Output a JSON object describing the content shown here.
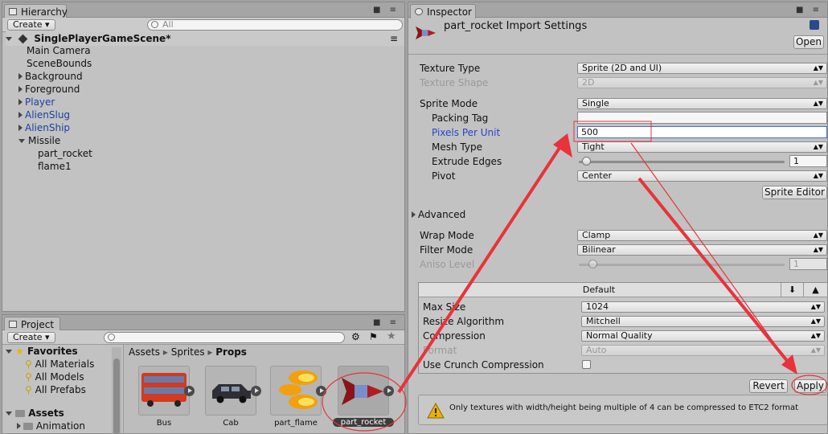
{
  "hierarchy": {
    "tab_title": "Hierarchy",
    "create_label": "Create",
    "search_placeholder": "All",
    "scene_name": "SinglePlayerGameScene*",
    "items": [
      {
        "label": "Main Camera"
      },
      {
        "label": "SceneBounds"
      },
      {
        "label": "Background"
      },
      {
        "label": "Foreground"
      },
      {
        "label": "Player"
      },
      {
        "label": "AlienSlug"
      },
      {
        "label": "AlienShip"
      },
      {
        "label": "Missile"
      },
      {
        "label": "part_rocket"
      },
      {
        "label": "flame1"
      }
    ]
  },
  "project": {
    "tab_title": "Project",
    "create_label": "Create",
    "favorites_label": "Favorites",
    "favorites": [
      "All Materials",
      "All Models",
      "All Prefabs"
    ],
    "assets_label": "Assets",
    "assets_children": [
      "Animation"
    ],
    "breadcrumb": [
      "Assets",
      "Sprites",
      "Props"
    ],
    "assets": [
      {
        "name": "Bus"
      },
      {
        "name": "Cab"
      },
      {
        "name": "part_flame"
      },
      {
        "name": "part_rocket"
      }
    ]
  },
  "inspector": {
    "tab_title": "Inspector",
    "title": "part_rocket Import Settings",
    "open_label": "Open",
    "texture_type_label": "Texture Type",
    "texture_type_value": "Sprite (2D and UI)",
    "texture_shape_label": "Texture Shape",
    "texture_shape_value": "2D",
    "sprite_mode_label": "Sprite Mode",
    "sprite_mode_value": "Single",
    "packing_tag_label": "Packing Tag",
    "packing_tag_value": "",
    "ppu_label": "Pixels Per Unit",
    "ppu_value": "500",
    "mesh_type_label": "Mesh Type",
    "mesh_type_value": "Tight",
    "extrude_label": "Extrude Edges",
    "extrude_value": "1",
    "pivot_label": "Pivot",
    "pivot_value": "Center",
    "sprite_editor_label": "Sprite Editor",
    "advanced_label": "Advanced",
    "wrap_label": "Wrap Mode",
    "wrap_value": "Clamp",
    "filter_label": "Filter Mode",
    "filter_value": "Bilinear",
    "aniso_label": "Aniso Level",
    "aniso_value": "1",
    "platform_tab": "Default",
    "max_size_label": "Max Size",
    "max_size_value": "1024",
    "resize_label": "Resize Algorithm",
    "resize_value": "Mitchell",
    "compression_label": "Compression",
    "compression_value": "Normal Quality",
    "format_label": "Format",
    "format_value": "Auto",
    "crunch_label": "Use Crunch Compression",
    "revert_label": "Revert",
    "apply_label": "Apply",
    "warning": "Only textures with width/height being multiple of 4 can be compressed to ETC2 format"
  },
  "colors": {
    "annotation": "#e8333a",
    "hierarchy_prefab": "#1d3fa5",
    "ppu_label": "#2a44c8"
  }
}
